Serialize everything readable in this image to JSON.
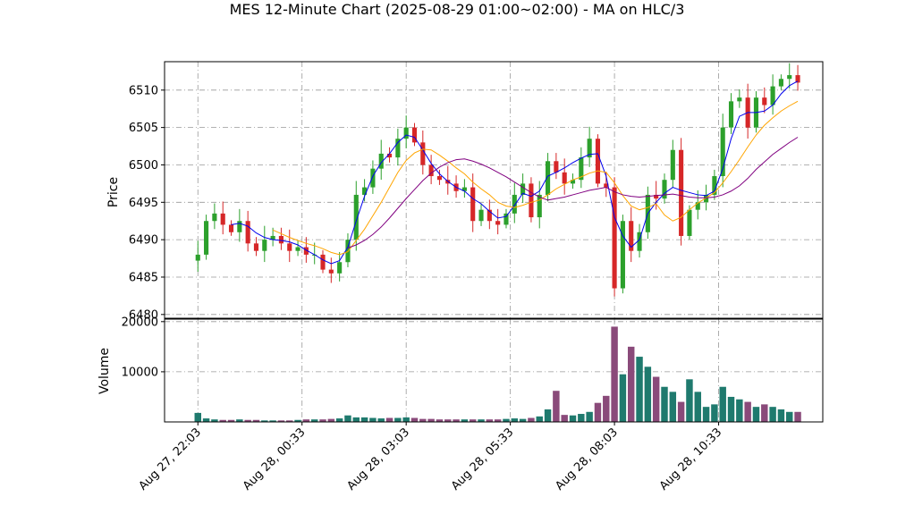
{
  "chart_data": {
    "type": "candlestick",
    "title": "MES 12-Minute Chart (2025-08-29 01:00~02:00) - MA on HLC/3",
    "price_panel": {
      "ylabel": "Price",
      "ylim": [
        6479.5,
        6513.8
      ],
      "yticks": [
        6480,
        6485,
        6490,
        6495,
        6500,
        6505,
        6510
      ],
      "grid": true
    },
    "volume_panel": {
      "ylabel": "Volume",
      "ylim": [
        0,
        20500
      ],
      "yticks": [
        10000,
        20000
      ],
      "grid": true
    },
    "xticks": [
      {
        "index": 0,
        "label": "Aug 27, 22:03"
      },
      {
        "index": 12.5,
        "label": "Aug 28, 00:33"
      },
      {
        "index": 25,
        "label": "Aug 28, 03:03"
      },
      {
        "index": 37.5,
        "label": "Aug 28, 05:33"
      },
      {
        "index": 50,
        "label": "Aug 28, 08:03"
      },
      {
        "index": 62.5,
        "label": "Aug 28, 10:33"
      }
    ],
    "xlim": [
      -4,
      75
    ],
    "candle_colors": {
      "up": "#2ca02c",
      "down": "#d62728"
    },
    "ma_colors": [
      "#0000ee",
      "#ffa500",
      "#800080"
    ],
    "close": [
      6488.0,
      6492.5,
      6493.5,
      6492.0,
      6491.0,
      6492.5,
      6489.5,
      6488.5,
      6490.0,
      6490.5,
      6489.5,
      6488.5,
      6489.0,
      6488.0,
      6488.0,
      6486.0,
      6485.5,
      6487.0,
      6490.0,
      6496.0,
      6497.0,
      6499.5,
      6501.5,
      6501.0,
      6503.5,
      6505.0,
      6503.0,
      6500.0,
      6498.5,
      6498.0,
      6497.5,
      6496.5,
      6497.0,
      6492.5,
      6494.0,
      6492.5,
      6492.0,
      6493.5,
      6496.0,
      6497.5,
      6493.0,
      6496.0,
      6500.5,
      6499.0,
      6497.5,
      6498.0,
      6501.0,
      6503.5,
      6497.5,
      6497.0,
      6483.5,
      6492.5,
      6488.5,
      6491.0,
      6496.0,
      6495.5,
      6498.0,
      6502.0,
      6490.5,
      6494.0,
      6495.0,
      6496.0,
      6498.5,
      6505.0,
      6508.5,
      6509.0,
      6505.0,
      6509.0,
      6508.0,
      6510.5,
      6511.5,
      6512.0,
      6511.0
    ],
    "ma": [
      {
        "values": [
          null,
          null,
          null,
          null,
          6492.0,
          6492.2,
          6491.8,
          6490.9,
          6490.3,
          6490.0,
          6489.9,
          6489.7,
          6489.3,
          6488.6,
          6488.0,
          6487.3,
          6486.8,
          6487.2,
          6489.0,
          6492.5,
          6495.8,
          6498.5,
          6500.3,
          6501.5,
          6503.0,
          6504.0,
          6503.7,
          6502.0,
          6500.2,
          6498.8,
          6497.8,
          6497.0,
          6496.5,
          6495.5,
          6494.8,
          6493.8,
          6492.9,
          6493.1,
          6494.6,
          6496.2,
          6495.8,
          6496.5,
          6498.5,
          6499.0,
          6499.6,
          6500.3,
          6500.9,
          6501.4,
          6501.5,
          6498.5,
          6493.0,
          6490.5,
          6489.0,
          6490.0,
          6493.5,
          6495.0,
          6496.2,
          6497.0,
          6496.6,
          6496.3,
          6496.0,
          6495.9,
          6496.5,
          6499.5,
          6503.5,
          6506.5,
          6507.0,
          6507.0,
          6507.2,
          6508.0,
          6509.5,
          6510.6,
          6511.2
        ]
      },
      {
        "values": [
          null,
          null,
          null,
          null,
          null,
          null,
          null,
          null,
          null,
          6491.3,
          6490.8,
          6490.3,
          6489.9,
          6489.5,
          6489.2,
          6488.8,
          6488.3,
          6488.0,
          6488.4,
          6489.9,
          6491.4,
          6493.2,
          6495.0,
          6497.0,
          6499.0,
          6500.6,
          6501.6,
          6502.1,
          6502.0,
          6501.3,
          6500.5,
          6499.6,
          6498.8,
          6497.7,
          6496.8,
          6496.0,
          6495.0,
          6494.5,
          6494.3,
          6494.6,
          6495.0,
          6495.3,
          6496.0,
          6496.8,
          6497.4,
          6498.0,
          6498.4,
          6498.9,
          6499.2,
          6499.0,
          6497.6,
          6495.9,
          6494.5,
          6494.0,
          6494.3,
          6494.8,
          6493.3,
          6492.5,
          6493.0,
          6494.0,
          6494.9,
          6495.6,
          6496.3,
          6497.6,
          6499.1,
          6500.7,
          6502.4,
          6504.0,
          6505.3,
          6506.3,
          6507.2,
          6507.9,
          6508.5
        ]
      },
      {
        "values": [
          null,
          null,
          null,
          null,
          null,
          null,
          null,
          null,
          null,
          null,
          null,
          null,
          null,
          null,
          null,
          null,
          null,
          null,
          6488.9,
          6489.3,
          6489.9,
          6490.7,
          6491.7,
          6492.9,
          6494.2,
          6495.5,
          6496.7,
          6497.9,
          6498.9,
          6499.7,
          6500.3,
          6500.7,
          6500.8,
          6500.5,
          6500.1,
          6499.6,
          6499.0,
          6498.4,
          6497.7,
          6497.0,
          6496.3,
          6495.7,
          6495.3,
          6495.5,
          6495.7,
          6496.0,
          6496.3,
          6496.6,
          6496.8,
          6497.0,
          6496.4,
          6496.0,
          6495.8,
          6495.7,
          6495.8,
          6495.9,
          6496.0,
          6496.1,
          6495.9,
          6495.7,
          6495.6,
          6495.6,
          6495.7,
          6496.0,
          6496.5,
          6497.2,
          6498.2,
          6499.4,
          6500.4,
          6501.4,
          6502.2,
          6503.0,
          6503.7
        ]
      }
    ],
    "volume": [
      1800,
      700,
      500,
      400,
      400,
      500,
      400,
      400,
      300,
      300,
      300,
      300,
      400,
      500,
      500,
      500,
      600,
      700,
      1300,
      900,
      900,
      800,
      700,
      800,
      800,
      900,
      800,
      600,
      600,
      500,
      500,
      500,
      500,
      500,
      500,
      500,
      500,
      600,
      700,
      600,
      800,
      1100,
      2500,
      6200,
      1400,
      1300,
      1600,
      2000,
      3800,
      5200,
      19000,
      9500,
      15000,
      13000,
      11000,
      9000,
      7000,
      6000,
      4000,
      8500,
      6000,
      3000,
      3500,
      7000,
      5000,
      4500,
      4000,
      3000,
      3500,
      3000,
      2500,
      2000,
      2000
    ]
  }
}
